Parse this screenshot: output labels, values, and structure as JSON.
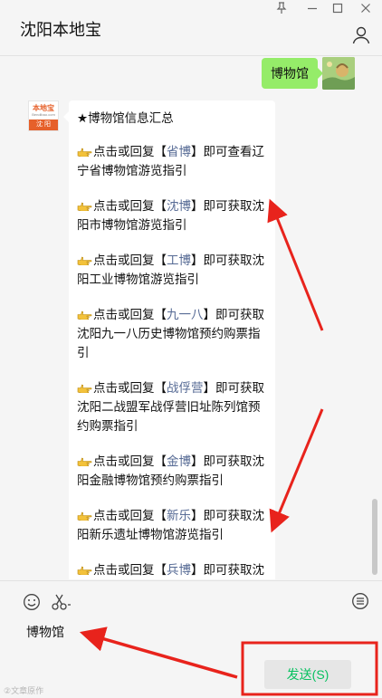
{
  "window": {
    "title": "沈阳本地宝",
    "controls": [
      "pin-icon",
      "minimize-icon",
      "maximize-icon",
      "close-icon"
    ]
  },
  "chat": {
    "outgoing": {
      "text": "博物馆"
    },
    "bot_avatar": {
      "top_text": "本地宝",
      "url_text": "Bendibao.com",
      "bar_text": "沈 阳"
    },
    "incoming": {
      "title": "★博物馆信息汇总",
      "items": [
        {
          "pre": "点击或回复【",
          "kw": "省博",
          "post": "】即可查看辽宁省博物馆游览指引"
        },
        {
          "pre": "点击或回复【",
          "kw": "沈博",
          "post": "】即可获取沈阳市博物馆游览指引"
        },
        {
          "pre": "点击或回复【",
          "kw": "工博",
          "post": "】即可获取沈阳工业博物馆游览指引"
        },
        {
          "pre": "点击或回复【",
          "kw": "九一八",
          "post": "】即可获取沈阳九一八历史博物馆预约购票指引"
        },
        {
          "pre": "点击或回复【",
          "kw": "战俘营",
          "post": "】即可获取沈阳二战盟军战俘营旧址陈列馆预约购票指引"
        },
        {
          "pre": "点击或回复【",
          "kw": "金博",
          "post": "】即可获取沈阳金融博物馆预约购票指引"
        },
        {
          "pre": "点击或回复【",
          "kw": "新乐",
          "post": "】即可获取沈阳新乐遗址博物馆游览指引"
        },
        {
          "pre": "点击或回复【",
          "kw": "兵博",
          "post": "】即可获取沈阳理工大学兵器博物馆游览指引"
        }
      ]
    }
  },
  "input": {
    "tools": [
      "emoji-icon",
      "scissors-icon",
      "chat-history-icon"
    ],
    "text": "博物馆",
    "send_label": "发送(S)"
  },
  "watermark": "②文章原作",
  "colors": {
    "accent_green": "#07c160",
    "bubble_green": "#95ec69",
    "keyword_blue": "#576b95",
    "annotation_red": "#e8231c"
  }
}
